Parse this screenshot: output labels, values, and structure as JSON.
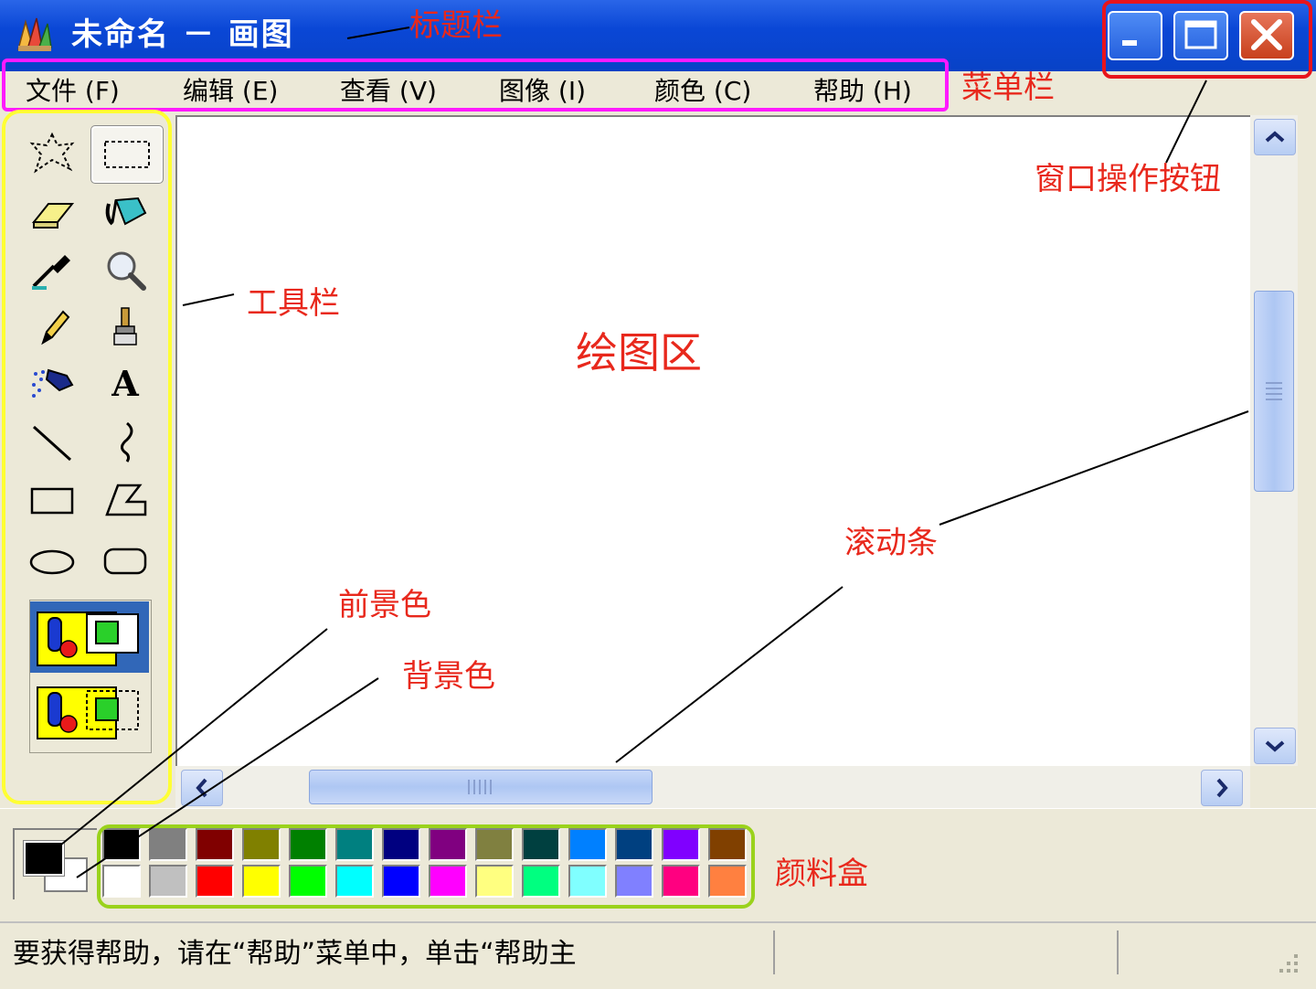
{
  "window": {
    "title": "未命名 － 画图",
    "buttons": {
      "minimize": "minimize",
      "maximize": "maximize",
      "close": "close"
    }
  },
  "menu": [
    "文件 (F)",
    "编辑 (E)",
    "查看 (V)",
    "图像 (I)",
    "颜色 (C)",
    "帮助 (H)"
  ],
  "tools": [
    "free-form-select-icon",
    "select-rect-icon",
    "eraser-icon",
    "fill-bucket-icon",
    "pick-color-icon",
    "magnifier-icon",
    "pencil-icon",
    "brush-icon",
    "airbrush-icon",
    "text-icon",
    "line-icon",
    "curve-icon",
    "rectangle-icon",
    "polygon-icon",
    "ellipse-icon",
    "rounded-rect-icon"
  ],
  "text_tool_glyph": "A",
  "palette": {
    "foreground": "#000000",
    "background": "#ffffff",
    "row1": [
      "#000000",
      "#808080",
      "#800000",
      "#808000",
      "#008000",
      "#008080",
      "#000080",
      "#800080",
      "#808040",
      "#004040",
      "#0080ff",
      "#004080",
      "#8000ff",
      "#804000"
    ],
    "row2": [
      "#ffffff",
      "#c0c0c0",
      "#ff0000",
      "#ffff00",
      "#00ff00",
      "#00ffff",
      "#0000ff",
      "#ff00ff",
      "#ffff80",
      "#00ff80",
      "#80ffff",
      "#8080ff",
      "#ff0080",
      "#ff8040"
    ]
  },
  "status_text": "要获得帮助，请在“帮助”菜单中，单击“帮助主",
  "annotations": {
    "title_bar": "标题栏",
    "menu_bar": "菜单栏",
    "window_buttons": "窗口操作按钮",
    "toolbar": "工具栏",
    "canvas": "绘图区",
    "scrollbar": "滚动条",
    "foreground_color": "前景色",
    "background_color": "背景色",
    "palette": "颜料盒"
  },
  "colors": {
    "annotation": "#e8281c",
    "title_bar": "#0a47d6"
  }
}
